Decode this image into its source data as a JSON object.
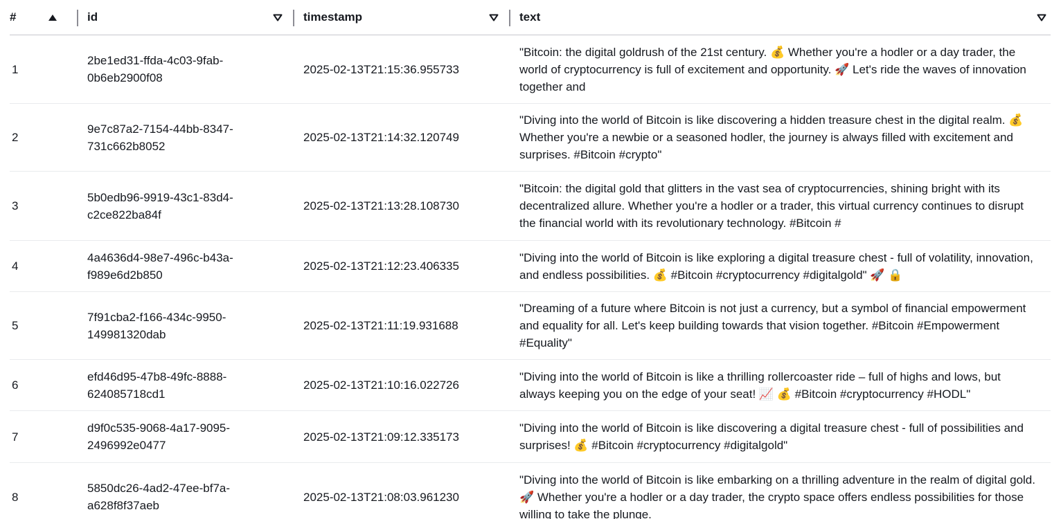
{
  "columns": {
    "index": "#",
    "id": "id",
    "timestamp": "timestamp",
    "text": "text"
  },
  "icons": {
    "sort_asc": "caret-up-filled-icon",
    "sort_desc": "caret-down-outline-icon"
  },
  "rows": [
    {
      "index": "1",
      "id": "2be1ed31-ffda-4c03-9fab-0b6eb2900f08",
      "timestamp": "2025-02-13T21:15:36.955733",
      "text": "\"Bitcoin: the digital goldrush of the 21st century. 💰 Whether you're a hodler or a day trader, the world of cryptocurrency is full of excitement and opportunity. 🚀 Let's ride the waves of innovation together and"
    },
    {
      "index": "2",
      "id": "9e7c87a2-7154-44bb-8347-731c662b8052",
      "timestamp": "2025-02-13T21:14:32.120749",
      "text": "\"Diving into the world of Bitcoin is like discovering a hidden treasure chest in the digital realm. 💰 Whether you're a newbie or a seasoned hodler, the journey is always filled with excitement and surprises. #Bitcoin #crypto\""
    },
    {
      "index": "3",
      "id": "5b0edb96-9919-43c1-83d4-c2ce822ba84f",
      "timestamp": "2025-02-13T21:13:28.108730",
      "text": "\"Bitcoin: the digital gold that glitters in the vast sea of cryptocurrencies, shining bright with its decentralized allure. Whether you're a hodler or a trader, this virtual currency continues to disrupt the financial world with its revolutionary technology. #Bitcoin #"
    },
    {
      "index": "4",
      "id": "4a4636d4-98e7-496c-b43a-f989e6d2b850",
      "timestamp": "2025-02-13T21:12:23.406335",
      "text": "\"Diving into the world of Bitcoin is like exploring a digital treasure chest - full of volatility, innovation, and endless possibilities. 💰 #Bitcoin #cryptocurrency #digitalgold\" 🚀 🔒"
    },
    {
      "index": "5",
      "id": "7f91cba2-f166-434c-9950-149981320dab",
      "timestamp": "2025-02-13T21:11:19.931688",
      "text": "\"Dreaming of a future where Bitcoin is not just a currency, but a symbol of financial empowerment and equality for all. Let's keep building towards that vision together. #Bitcoin #Empowerment #Equality\""
    },
    {
      "index": "6",
      "id": "efd46d95-47b8-49fc-8888-624085718cd1",
      "timestamp": "2025-02-13T21:10:16.022726",
      "text": "\"Diving into the world of Bitcoin is like a thrilling rollercoaster ride – full of highs and lows, but always keeping you on the edge of your seat! 📈 💰 #Bitcoin #cryptocurrency #HODL\""
    },
    {
      "index": "7",
      "id": "d9f0c535-9068-4a17-9095-2496992e0477",
      "timestamp": "2025-02-13T21:09:12.335173",
      "text": "\"Diving into the world of Bitcoin is like discovering a digital treasure chest - full of possibilities and surprises! 💰 #Bitcoin #cryptocurrency #digitalgold\""
    },
    {
      "index": "8",
      "id": "5850dc26-4ad2-47ee-bf7a-a628f8f37aeb",
      "timestamp": "2025-02-13T21:08:03.961230",
      "text": "\"Diving into the world of Bitcoin is like embarking on a thrilling adventure in the realm of digital gold. 🚀 Whether you're a hodler or a day trader, the crypto space offers endless possibilities for those willing to take the plunge."
    }
  ]
}
